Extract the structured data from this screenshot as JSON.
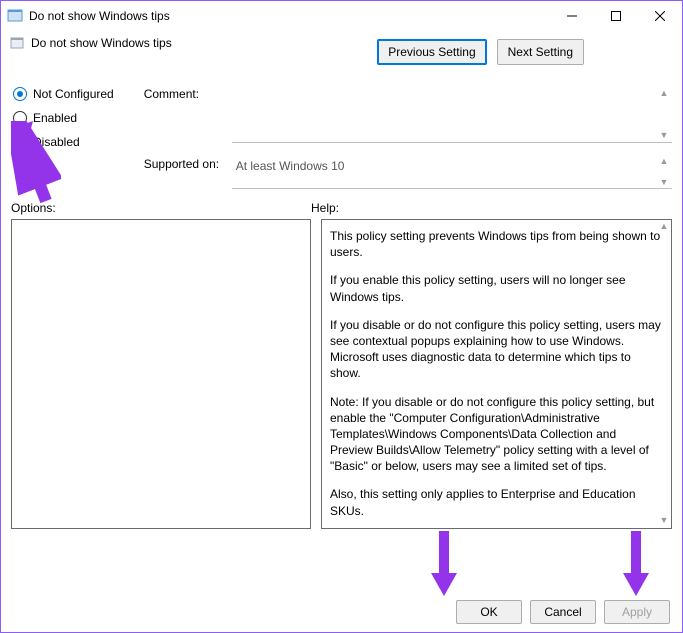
{
  "title": "Do not show Windows tips",
  "subtitle": "Do not show Windows tips",
  "nav": {
    "prev": "Previous Setting",
    "next": "Next Setting"
  },
  "radios": {
    "not_configured": "Not Configured",
    "enabled": "Enabled",
    "disabled": "Disabled"
  },
  "labels": {
    "comment": "Comment:",
    "supported": "Supported on:",
    "options": "Options:",
    "help": "Help:"
  },
  "supported_text": "At least Windows 10",
  "help": {
    "p1": "This policy setting prevents Windows tips from being shown to users.",
    "p2": "If you enable this policy setting, users will no longer see Windows tips.",
    "p3": "If you disable or do not configure this policy setting, users may see contextual popups explaining how to use Windows. Microsoft uses diagnostic data to determine which tips to show.",
    "p4": "Note: If you disable or do not configure this policy setting, but enable the \"Computer Configuration\\Administrative Templates\\Windows Components\\Data Collection and Preview Builds\\Allow Telemetry\" policy setting with a level of \"Basic\" or below, users may see a limited set of tips.",
    "p5": "Also, this setting only applies to Enterprise and Education SKUs."
  },
  "buttons": {
    "ok": "OK",
    "cancel": "Cancel",
    "apply": "Apply"
  }
}
